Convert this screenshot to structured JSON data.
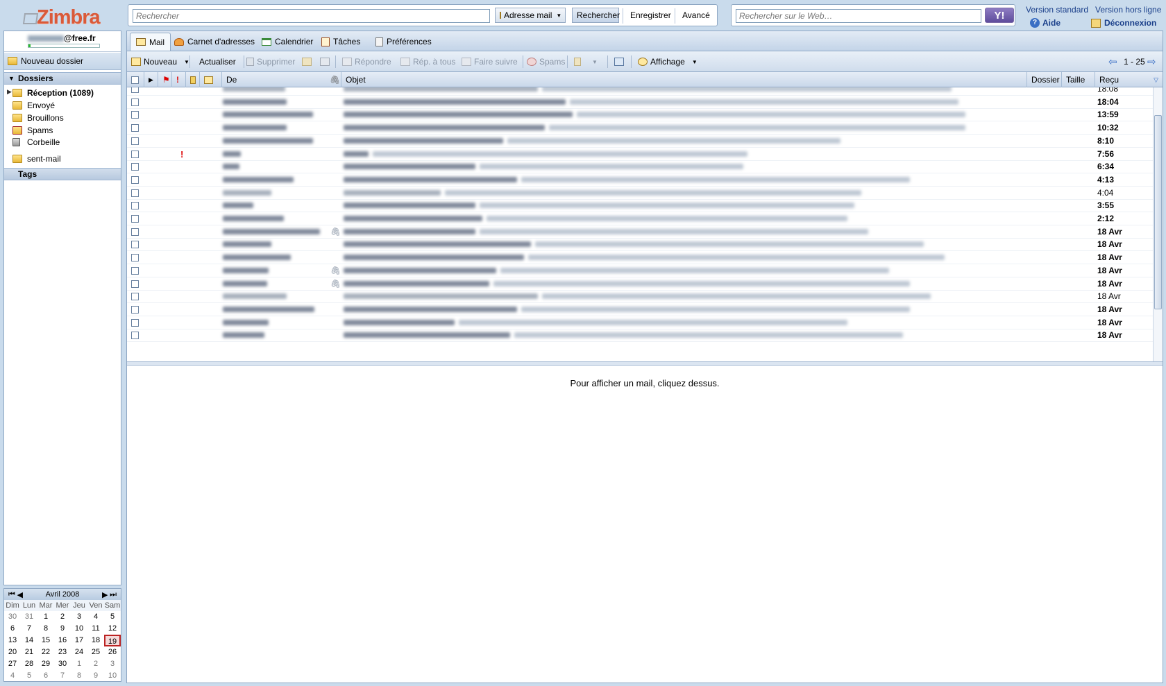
{
  "brand": {
    "logo_text": "Zimbra"
  },
  "search": {
    "placeholder": "Rechercher",
    "scope_label": "Adresse mail",
    "search_label": "Rechercher",
    "save_label": "Enregistrer",
    "advanced_label": "Avancé"
  },
  "web_search": {
    "placeholder": "Rechercher sur le Web…",
    "button_label": "Y!"
  },
  "top_links": {
    "standard": "Version standard",
    "offline": "Version hors ligne",
    "help": "Aide",
    "logout": "Déconnexion"
  },
  "account": {
    "email_domain": "@free.fr",
    "quota_fraction": 0.03
  },
  "sidebar": {
    "new_folder": "Nouveau dossier",
    "folders_header": "Dossiers",
    "folders": [
      {
        "label": "Réception (1089)",
        "bold": true
      },
      {
        "label": "Envoyé"
      },
      {
        "label": "Brouillons"
      },
      {
        "label": "Spams"
      },
      {
        "label": "Corbeille"
      },
      {
        "label": "sent-mail"
      }
    ],
    "tags_header": "Tags"
  },
  "calendar": {
    "month_label": "Avril 2008",
    "nav": {
      "prev_year": "⏮",
      "prev_month": "◀",
      "next_month": "▶",
      "next_year": "⏭"
    },
    "weekdays": [
      "Dim",
      "Lun",
      "Mar",
      "Mer",
      "Jeu",
      "Ven",
      "Sam"
    ],
    "weeks": [
      [
        "30",
        "31",
        "1",
        "2",
        "3",
        "4",
        "5"
      ],
      [
        "6",
        "7",
        "8",
        "9",
        "10",
        "11",
        "12"
      ],
      [
        "13",
        "14",
        "15",
        "16",
        "17",
        "18",
        "19"
      ],
      [
        "20",
        "21",
        "22",
        "23",
        "24",
        "25",
        "26"
      ],
      [
        "27",
        "28",
        "29",
        "30",
        "1",
        "2",
        "3"
      ],
      [
        "4",
        "5",
        "6",
        "7",
        "8",
        "9",
        "10"
      ]
    ],
    "today": "19"
  },
  "tabs": [
    {
      "label": "Mail",
      "active": true
    },
    {
      "label": "Carnet d'adresses"
    },
    {
      "label": "Calendrier"
    },
    {
      "label": "Tâches"
    },
    {
      "label": "Préférences"
    }
  ],
  "toolbar": {
    "new": "Nouveau",
    "refresh": "Actualiser",
    "delete": "Supprimer",
    "reply": "Répondre",
    "reply_all": "Rép. à tous",
    "forward": "Faire suivre",
    "spam": "Spams",
    "view": "Affichage",
    "pagination": "1 - 25"
  },
  "list_header": {
    "from": "De",
    "subject": "Objet",
    "folder": "Dossier",
    "size": "Taille",
    "received": "Reçu"
  },
  "messages": [
    {
      "date": "18:08",
      "unread": false
    },
    {
      "date": "18:04",
      "unread": true
    },
    {
      "date": "13:59",
      "unread": true
    },
    {
      "date": "10:32",
      "unread": true
    },
    {
      "date": "8:10",
      "unread": true
    },
    {
      "date": "7:56",
      "unread": true,
      "urgent": true
    },
    {
      "date": "6:34",
      "unread": true
    },
    {
      "date": "4:13",
      "unread": true
    },
    {
      "date": "4:04",
      "unread": false
    },
    {
      "date": "3:55",
      "unread": true
    },
    {
      "date": "2:12",
      "unread": true
    },
    {
      "date": "18 Avr",
      "unread": true,
      "attachment": true
    },
    {
      "date": "18 Avr",
      "unread": true
    },
    {
      "date": "18 Avr",
      "unread": true
    },
    {
      "date": "18 Avr",
      "unread": true,
      "attachment": true
    },
    {
      "date": "18 Avr",
      "unread": true,
      "attachment": true
    },
    {
      "date": "18 Avr",
      "unread": false
    },
    {
      "date": "18 Avr",
      "unread": true
    },
    {
      "date": "18 Avr",
      "unread": true
    },
    {
      "date": "18 Avr",
      "unread": true
    }
  ],
  "reading_pane": {
    "message": "Pour afficher un mail, cliquez dessus."
  }
}
